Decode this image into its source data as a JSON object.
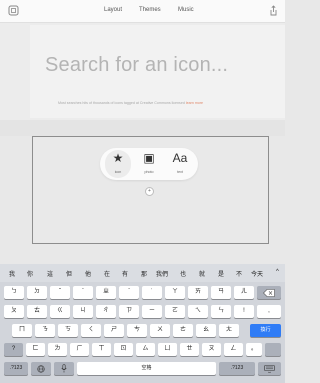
{
  "topbar": {
    "links": [
      "Layout",
      "Themes",
      "Music"
    ],
    "left_icon": "app-icon",
    "right_icon": "share-icon"
  },
  "hero": {
    "title": "Search for an icon...",
    "subtitle": "Most searches hits of thousands of icons tagged at Creative Commons licensed",
    "learn_more": "learn more"
  },
  "filter": {
    "items": [
      {
        "label": "icon",
        "glyph": "★"
      },
      {
        "label": "photo",
        "glyph": "▣"
      },
      {
        "label": "text",
        "glyph": "Aa"
      }
    ],
    "add": "+"
  },
  "candidates": [
    "我",
    "你",
    "這",
    "但",
    "他",
    "在",
    "有",
    "那",
    "我們",
    "也",
    "就",
    "是",
    "不",
    "今天",
    "^"
  ],
  "keyboard": {
    "row1": [
      "ㄅ",
      "ㄉ",
      "ˇ",
      "ˋ",
      "ㄓ",
      "ˊ",
      "˙",
      "ㄚ",
      "ㄞ",
      "ㄢ",
      "ㄦ"
    ],
    "row2": [
      "ㄆ",
      "ㄊ",
      "ㄍ",
      "ㄐ",
      "ㄔ",
      "ㄗ",
      "ㄧ",
      "ㄛ",
      "ㄟ",
      "ㄣ",
      "!"
    ],
    "row3": [
      "ㄇ",
      "ㄋ",
      "ㄎ",
      "ㄑ",
      "ㄕ",
      "ㄘ",
      "ㄨ",
      "ㄜ",
      "ㄠ",
      "ㄤ"
    ],
    "row4": [
      "?",
      "ㄈ",
      "ㄌ",
      "ㄏ",
      "ㄒ",
      "ㄖ",
      "ㄙ",
      "ㄩ",
      "ㄝ",
      "ㄡ",
      "ㄥ",
      "。"
    ],
    "row2_end": ",",
    "return_label": "換行",
    "space_label": "空格",
    "mode_left": ".?123",
    "mode_right": ".?123",
    "backspace_icon": "backspace-icon",
    "globe_icon": "globe-icon",
    "mic_icon": "mic-icon",
    "hide_icon": "keyboard-hide-icon"
  },
  "colors": {
    "accent_link": "#e0876a",
    "return_key": "#2f7cf6"
  }
}
